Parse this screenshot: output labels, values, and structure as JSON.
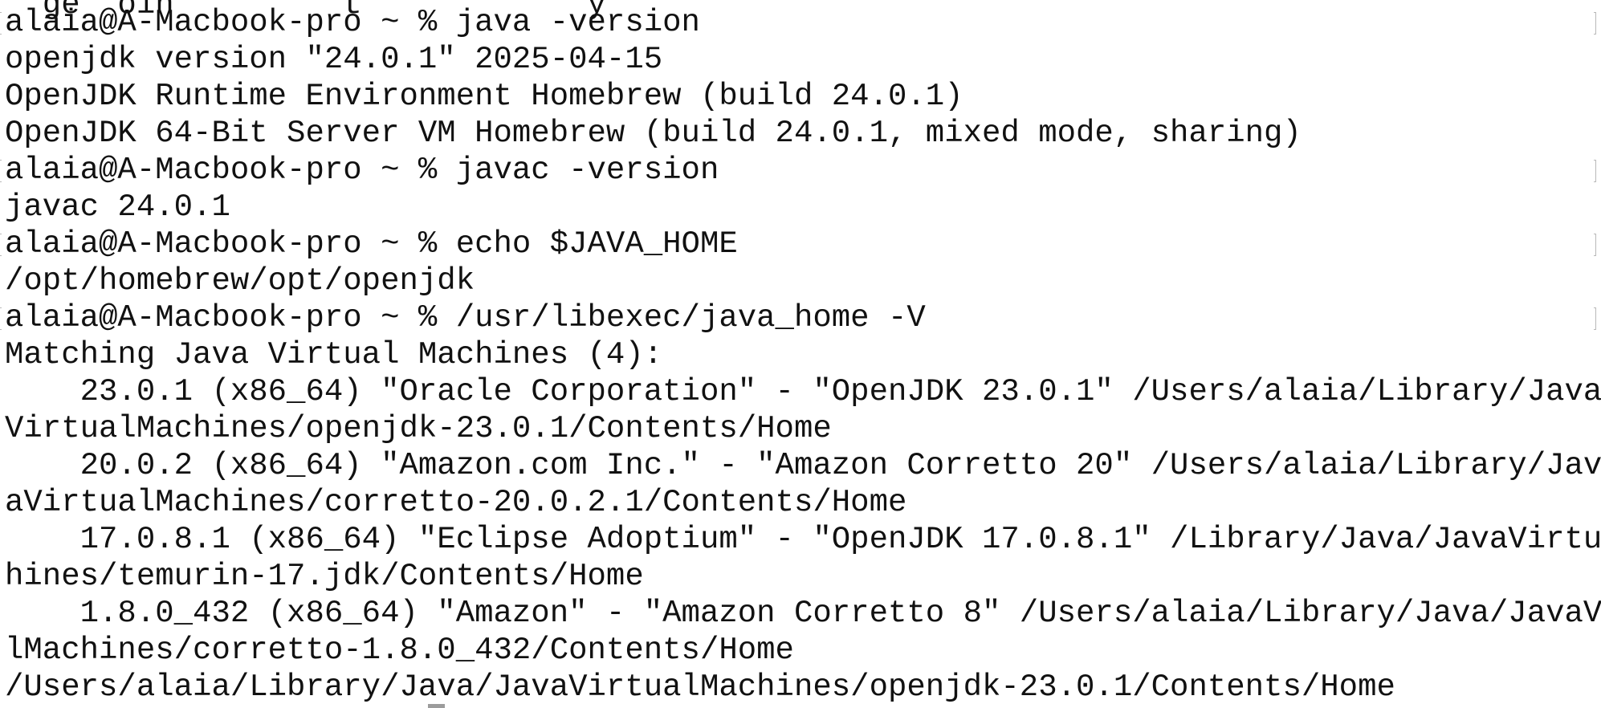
{
  "terminal": {
    "lines": [
      "  ge  oin         t            y",
      "alaia@A-Macbook-pro ~ % java -version",
      "openjdk version \"24.0.1\" 2025-04-15",
      "OpenJDK Runtime Environment Homebrew (build 24.0.1)",
      "OpenJDK 64-Bit Server VM Homebrew (build 24.0.1, mixed mode, sharing)",
      "alaia@A-Macbook-pro ~ % javac -version",
      "javac 24.0.1",
      "alaia@A-Macbook-pro ~ % echo $JAVA_HOME",
      "/opt/homebrew/opt/openjdk",
      "alaia@A-Macbook-pro ~ % /usr/libexec/java_home -V",
      "Matching Java Virtual Machines (4):",
      "    23.0.1 (x86_64) \"Oracle Corporation\" - \"OpenJDK 23.0.1\" /Users/alaia/Library/Java/Java",
      "VirtualMachines/openjdk-23.0.1/Contents/Home",
      "    20.0.2 (x86_64) \"Amazon.com Inc.\" - \"Amazon Corretto 20\" /Users/alaia/Library/Java/Jav",
      "aVirtualMachines/corretto-20.0.2.1/Contents/Home",
      "    17.0.8.1 (x86_64) \"Eclipse Adoptium\" - \"OpenJDK 17.0.8.1\" /Library/Java/JavaVirtualMac",
      "hines/temurin-17.jdk/Contents/Home",
      "    1.8.0_432 (x86_64) \"Amazon\" - \"Amazon Corretto 8\" /Users/alaia/Library/Java/JavaVirtua",
      "lMachines/corretto-1.8.0_432/Contents/Home",
      "/Users/alaia/Library/Java/JavaVirtualMachines/openjdk-23.0.1/Contents/Home"
    ]
  }
}
